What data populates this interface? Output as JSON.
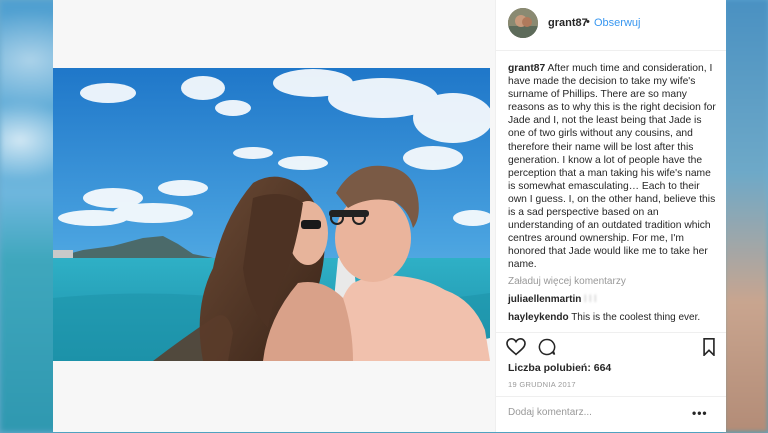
{
  "header": {
    "username": "grant87",
    "separator": "•",
    "follow_label": "Obserwuj"
  },
  "caption": {
    "username": "grant87",
    "text": "After much time and consideration, I have made the decision to take my wife's surname of Phillips. There are so many reasons as to why this is the right decision for Jade and I, not the least being that Jade is one of two girls without any cousins, and therefore their name will be lost after this generation. I know a lot of people have the perception that a man taking his wife's name is somewhat emasculating… Each to their own I guess. I, on the other hand, believe this is a sad perspective based on an understanding of an outdated tradition which centres around ownership. For me, I'm honored that Jade would like me to take her name."
  },
  "load_more_label": "Załaduj więcej komentarzy",
  "comments": [
    {
      "username": "juliaellenmartin",
      "text": "l l l"
    },
    {
      "username": "hayleykendo",
      "text": "This is the coolest thing ever."
    }
  ],
  "actions": {
    "like_icon": "heart-icon",
    "comment_icon": "comment-bubble-icon",
    "save_icon": "bookmark-icon"
  },
  "likes_label": "Liczba polubień: 664",
  "date": "19 GRUDNIA 2017",
  "add_comment_placeholder": "Dodaj komentarz...",
  "more_icon": "more-options-icon",
  "more_glyph": "•••",
  "colors": {
    "link_blue": "#3897f0",
    "text": "#262626",
    "muted": "#999999"
  }
}
